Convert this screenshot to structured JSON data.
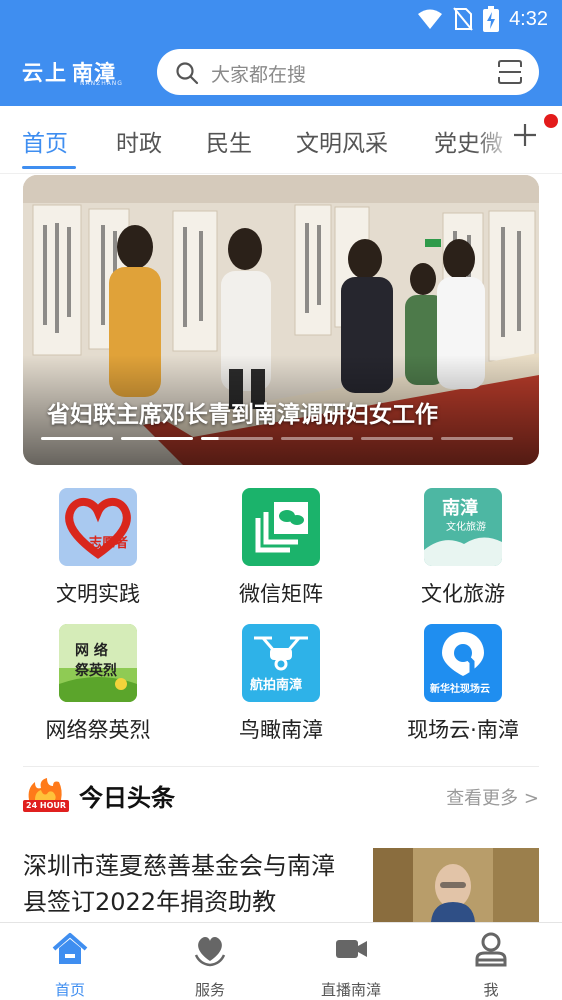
{
  "status_bar": {
    "time": "4:32"
  },
  "header": {
    "logo_main": "云上",
    "logo_place": "南漳",
    "logo_sub": "NANZHANG",
    "search_placeholder": "大家都在搜"
  },
  "tabs": [
    {
      "label": "首页",
      "active": true
    },
    {
      "label": "时政"
    },
    {
      "label": "民生"
    },
    {
      "label": "文明风采"
    },
    {
      "label": "党史微"
    }
  ],
  "banner": {
    "title": "省妇联主席邓长青到南漳调研妇女工作",
    "slide_count": 6,
    "active_slide": 2
  },
  "shortcuts": [
    {
      "label": "文明实践",
      "icon": "volunteer-heart-icon",
      "icon_text": "志愿者"
    },
    {
      "label": "微信矩阵",
      "icon": "wechat-matrix-icon"
    },
    {
      "label": "文化旅游",
      "icon": "culture-tourism-icon",
      "icon_text_1": "南漳",
      "icon_text_2": "文化旅游"
    },
    {
      "label": "网络祭英烈",
      "icon": "memorial-icon",
      "icon_text_1": "网 络",
      "icon_text_2": "祭英烈"
    },
    {
      "label": "鸟瞰南漳",
      "icon": "drone-icon",
      "icon_text": "航拍南漳"
    },
    {
      "label": "现场云·南漳",
      "icon": "live-cloud-icon",
      "icon_text": "新华社现场云"
    }
  ],
  "headlines": {
    "title": "今日头条",
    "more": "查看更多 >",
    "badge_text": "24 HOUR",
    "items": [
      {
        "title": "深圳市莲夏慈善基金会与南漳县签订2022年捐资助教"
      }
    ]
  },
  "bottom_nav": [
    {
      "label": "首页",
      "icon": "home-icon",
      "active": true
    },
    {
      "label": "服务",
      "icon": "service-heart-icon"
    },
    {
      "label": "直播南漳",
      "icon": "video-camera-icon"
    },
    {
      "label": "我",
      "icon": "user-icon"
    }
  ],
  "colors": {
    "brand": "#3f8ef0",
    "notice": "#e31b1b"
  }
}
